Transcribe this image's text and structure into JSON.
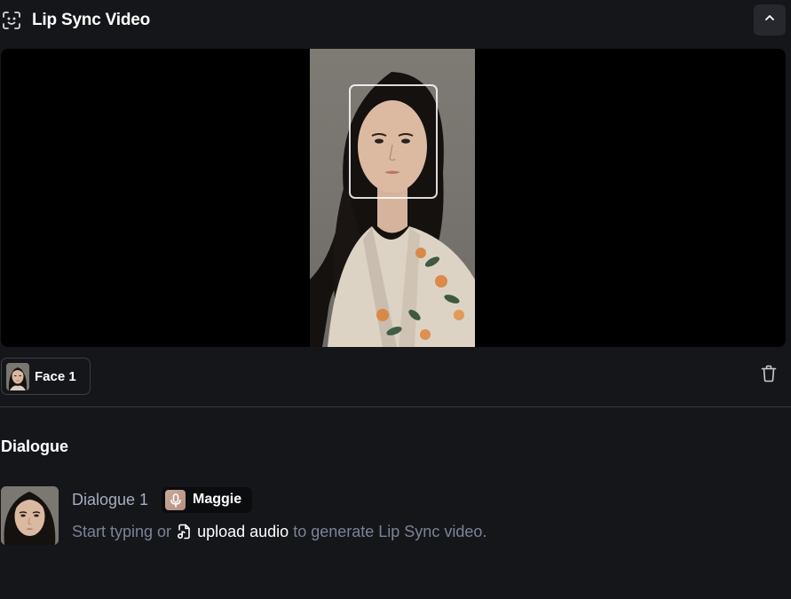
{
  "header": {
    "title": "Lip Sync Video",
    "title_icon": "face-scan-icon",
    "collapse_icon": "chevron-up-icon"
  },
  "preview": {
    "face_label": "Face 1",
    "delete_icon": "trash-icon"
  },
  "dialogue_section": {
    "title": "Dialogue",
    "items": [
      {
        "name": "Dialogue 1",
        "voice": "Maggie",
        "voice_icon": "microphone-icon",
        "hint_before": "Start typing or",
        "upload_label": "upload audio",
        "upload_icon": "audio-file-icon",
        "hint_after": "to generate Lip Sync video."
      }
    ]
  },
  "colors": {
    "background": "#15161a",
    "video_background": "#000000",
    "muted_text": "#7b8396",
    "dialogue_name": "#a6aec0",
    "border": "#3a3c42"
  }
}
